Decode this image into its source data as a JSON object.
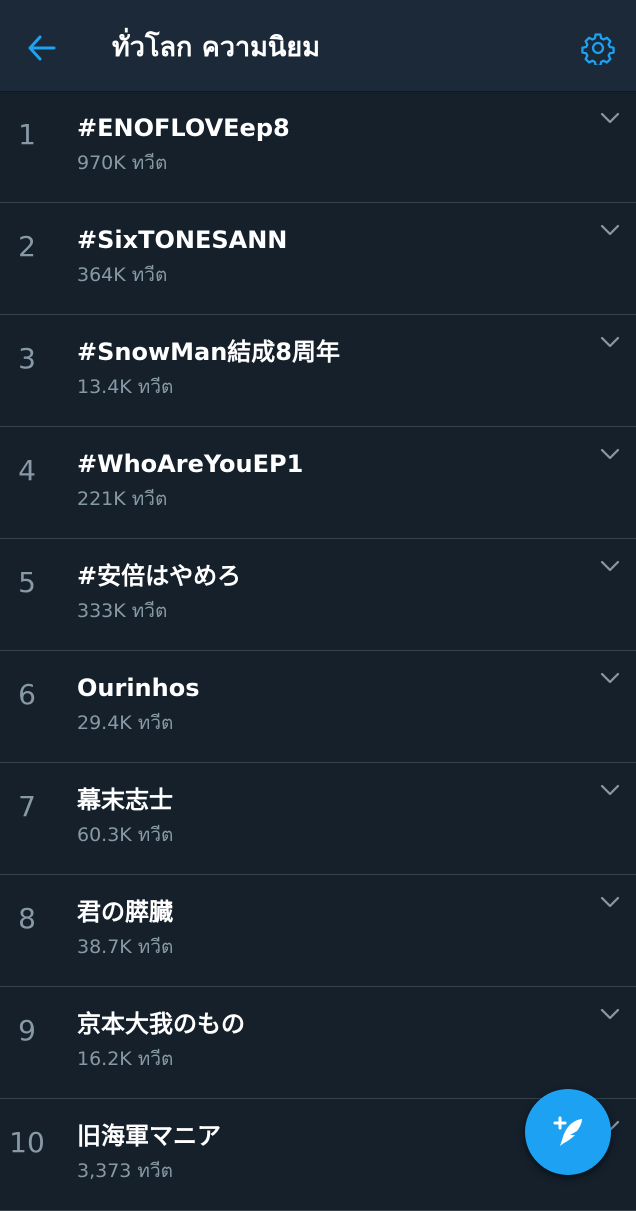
{
  "header": {
    "title": "ทั่วโลก ความนิยม",
    "back_icon": "arrow-left-icon",
    "settings_icon": "gear-icon"
  },
  "trends": [
    {
      "rank": "1",
      "name": "#ENOFLOVEep8",
      "count": "970K ทวีต"
    },
    {
      "rank": "2",
      "name": "#SixTONESANN",
      "count": "364K ทวีต"
    },
    {
      "rank": "3",
      "name": "#SnowMan結成8周年",
      "count": "13.4K ทวีต"
    },
    {
      "rank": "4",
      "name": "#WhoAreYouEP1",
      "count": "221K ทวีต"
    },
    {
      "rank": "5",
      "name": "#安倍はやめろ",
      "count": "333K ทวีต"
    },
    {
      "rank": "6",
      "name": "Ourinhos",
      "count": "29.4K ทวีต"
    },
    {
      "rank": "7",
      "name": "幕末志士",
      "count": "60.3K ทวีต"
    },
    {
      "rank": "8",
      "name": "君の膵臓",
      "count": "38.7K ทวีต"
    },
    {
      "rank": "9",
      "name": "京本大我のもの",
      "count": "16.2K ทวีต"
    },
    {
      "rank": "10",
      "name": "旧海軍マニア",
      "count": "3,373 ทวีต"
    }
  ],
  "fab": {
    "icon": "compose-tweet-icon"
  },
  "colors": {
    "background": "#15202b",
    "header": "#1c2938",
    "accent": "#1da1f2",
    "secondary_text": "#8899a6",
    "divider": "#38444d"
  }
}
